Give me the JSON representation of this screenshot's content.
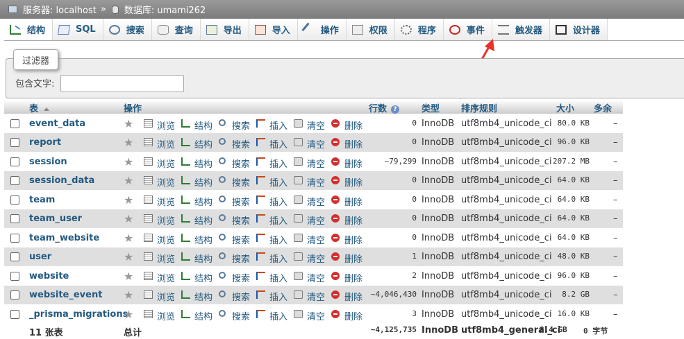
{
  "breadcrumb": {
    "server_label": "服务器: localhost",
    "separator": "»",
    "database_label": "数据库: umami262"
  },
  "tabs": [
    {
      "label": "结构",
      "icon": "structure-icon",
      "active": true
    },
    {
      "label": "SQL",
      "icon": "sql-icon"
    },
    {
      "label": "搜索",
      "icon": "search-icon"
    },
    {
      "label": "查询",
      "icon": "query-icon"
    },
    {
      "label": "导出",
      "icon": "export-icon"
    },
    {
      "label": "导入",
      "icon": "import-icon"
    },
    {
      "label": "操作",
      "icon": "operations-icon"
    },
    {
      "label": "权限",
      "icon": "privileges-icon"
    },
    {
      "label": "程序",
      "icon": "routines-icon"
    },
    {
      "label": "事件",
      "icon": "events-icon"
    },
    {
      "label": "触发器",
      "icon": "triggers-icon"
    },
    {
      "label": "设计器",
      "icon": "designer-icon"
    }
  ],
  "filter": {
    "legend": "过滤器",
    "label": "包含文字:",
    "value": ""
  },
  "columns": {
    "table": "表",
    "action": "操作",
    "rows": "行数",
    "type": "类型",
    "collation": "排序规则",
    "size": "大小",
    "overhead": "多余"
  },
  "actions": {
    "browse": "浏览",
    "structure": "结构",
    "search": "搜索",
    "insert": "插入",
    "empty": "清空",
    "drop": "删除"
  },
  "tables": [
    {
      "name": "event_data",
      "rows": "0",
      "type": "InnoDB",
      "collation": "utf8mb4_unicode_ci",
      "size": "80.0 KB",
      "overhead": "–"
    },
    {
      "name": "report",
      "rows": "0",
      "type": "InnoDB",
      "collation": "utf8mb4_unicode_ci",
      "size": "96.0 KB",
      "overhead": "–"
    },
    {
      "name": "session",
      "rows": "~79,299",
      "type": "InnoDB",
      "collation": "utf8mb4_unicode_ci",
      "size": "207.2 MB",
      "overhead": "–"
    },
    {
      "name": "session_data",
      "rows": "0",
      "type": "InnoDB",
      "collation": "utf8mb4_unicode_ci",
      "size": "64.0 KB",
      "overhead": "–"
    },
    {
      "name": "team",
      "rows": "0",
      "type": "InnoDB",
      "collation": "utf8mb4_unicode_ci",
      "size": "64.0 KB",
      "overhead": "–"
    },
    {
      "name": "team_user",
      "rows": "0",
      "type": "InnoDB",
      "collation": "utf8mb4_unicode_ci",
      "size": "64.0 KB",
      "overhead": "–"
    },
    {
      "name": "team_website",
      "rows": "0",
      "type": "InnoDB",
      "collation": "utf8mb4_unicode_ci",
      "size": "64.0 KB",
      "overhead": "–"
    },
    {
      "name": "user",
      "rows": "1",
      "type": "InnoDB",
      "collation": "utf8mb4_unicode_ci",
      "size": "48.0 KB",
      "overhead": "–"
    },
    {
      "name": "website",
      "rows": "2",
      "type": "InnoDB",
      "collation": "utf8mb4_unicode_ci",
      "size": "96.0 KB",
      "overhead": "–"
    },
    {
      "name": "website_event",
      "rows": "~4,046,430",
      "type": "InnoDB",
      "collation": "utf8mb4_unicode_ci",
      "size": "8.2 GB",
      "overhead": "–"
    },
    {
      "name": "_prisma_migrations",
      "rows": "3",
      "type": "InnoDB",
      "collation": "utf8mb4_unicode_ci",
      "size": "16.0 KB",
      "overhead": "–"
    }
  ],
  "footer": {
    "count": "11 张表",
    "total_label": "总计",
    "rows": "~4,125,735",
    "type": "InnoDB",
    "collation": "utf8mb4_general_ci",
    "size": "8.4 GB",
    "overhead": "0 字节"
  },
  "colors": {
    "link": "#235a81",
    "row_alt": "#dfdfdf",
    "arrow": "#e8322a",
    "drop_icon": "#d32f2f"
  }
}
